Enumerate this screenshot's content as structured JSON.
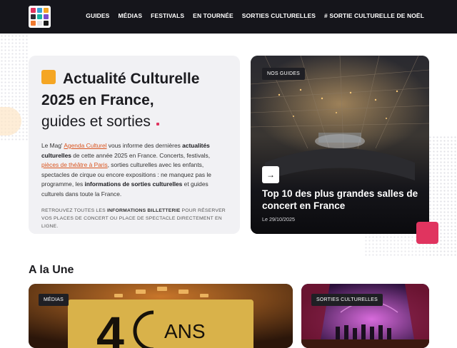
{
  "header": {
    "logo_colors": [
      "#e0345f",
      "#3aa0d8",
      "#f5a623",
      "#2c2c34",
      "#16b3a4",
      "#7c4dcc",
      "#f07a30",
      "#e4e4e8",
      "#1a1a1a"
    ],
    "nav": [
      "GUIDES",
      "MÉDIAS",
      "FESTIVALS",
      "EN TOURNÉE",
      "SORTIES CULTURELLES",
      "# SORTIE CULTURELLE DE NOËL"
    ]
  },
  "hero": {
    "title_line1": "Actualité Culturelle",
    "title_line2": "2025 en France,",
    "title_line3": "guides et sorties",
    "intro": {
      "p1": "Le Mag' ",
      "link1": "Agenda Culturel",
      "p2": " vous informe des dernières ",
      "b1": "actualités culturelles",
      "p3": " de cette année 2025 en France. Concerts, festivals, ",
      "link2": "pièces de théâtre à Paris",
      "p4": ", sorties culturelles avec les enfants, spectacles de cirque ou encore expositions : ne manquez pas le programme, les ",
      "b2": "informations de sorties culturelles",
      "p5": " et guides culturels dans toute la France."
    },
    "small": {
      "s1": "RETROUVEZ TOUTES LES ",
      "b1": "INFORMATIONS BILLETTERIE",
      "s2": " POUR RÉSERVER VOS PLACES DE CONCERT OU PLACE DE SPECTACLE DIRECTEMENT EN LIGNE."
    },
    "accent_color": "#f5a623",
    "pink_color": "#e0345f"
  },
  "featured": {
    "tag": "NOS GUIDES",
    "arrow": "→",
    "title": "Top 10 des plus grandes salles de concert en France",
    "date": "Le 29/10/2025"
  },
  "a_la_une": {
    "title": "A la Une",
    "cards": [
      {
        "tag": "MÉDIAS",
        "image_text": "ANS"
      },
      {
        "tag": "SORTIES CULTURELLES"
      }
    ]
  }
}
